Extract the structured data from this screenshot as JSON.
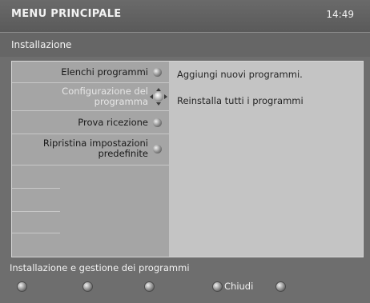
{
  "header": {
    "title": "MENU PRINCIPALE",
    "clock": "14:49"
  },
  "section": {
    "title": "Installazione"
  },
  "menu": {
    "items": [
      {
        "label": "Elenchi programmi"
      },
      {
        "label": "Configurazione del programma"
      },
      {
        "label": "Prova ricezione"
      },
      {
        "label": "Ripristina impostazioni predefinite"
      }
    ]
  },
  "details": {
    "lines": [
      "Aggiungi nuovi programmi.",
      "Reinstalla tutti i programmi"
    ]
  },
  "footer": {
    "status": "Installazione e gestione dei programmi",
    "close_label": "Chiudi"
  },
  "icons": {
    "menu_knob": "select-knob-icon",
    "nav_knob": "navigation-cross-icon",
    "color_button": "remote-color-button-icon"
  },
  "colors": {
    "background": "#6e6e6e",
    "panel_left": "#a5a5a5",
    "panel_right": "#c4c4c4",
    "text_light": "#f2f2f2",
    "text_dark": "#1a1a1a"
  }
}
